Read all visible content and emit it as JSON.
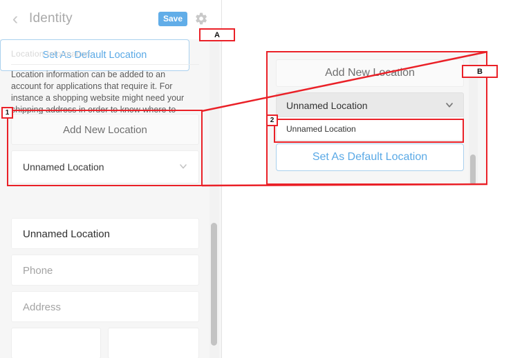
{
  "app": {
    "header": {
      "title": "Identity",
      "back_icon": "chevron-left-icon",
      "save_label": "Save",
      "settings_icon": "gear-icon"
    },
    "section": {
      "label": "Location Information",
      "description": "Location information can be added to an account for applications that require it. For instance a shopping website might need your shipping address in order to know where to send your purchased goods to."
    },
    "add_new_location_label": "Add New Location",
    "location_select": {
      "value": "Unnamed Location",
      "chevron_icon": "chevron-down-icon",
      "options": [
        "Unnamed Location"
      ]
    },
    "set_default_label": "Set As Default Location",
    "fields": [
      {
        "name": "name",
        "value": "Unnamed Location",
        "placeholder": ""
      },
      {
        "name": "phone",
        "value": "",
        "placeholder": "Phone"
      },
      {
        "name": "address",
        "value": "",
        "placeholder": "Address"
      }
    ]
  },
  "zoom_panel": {
    "add_new_location_label": "Add New Location",
    "select_value": "Unnamed Location",
    "chevron_icon": "chevron-down-icon",
    "option_label": "Unnamed Location",
    "set_default_label": "Set As Default Location"
  },
  "annotations": {
    "label_a": "A",
    "label_b": "B",
    "marker_1": "1",
    "marker_2": "2",
    "accent_color": "#ea2027"
  },
  "colors": {
    "save_button": "#61ade8",
    "link_blue": "#5aa9e6",
    "panel_bg": "#f6f6f6",
    "annotation_red": "#ea2027"
  }
}
